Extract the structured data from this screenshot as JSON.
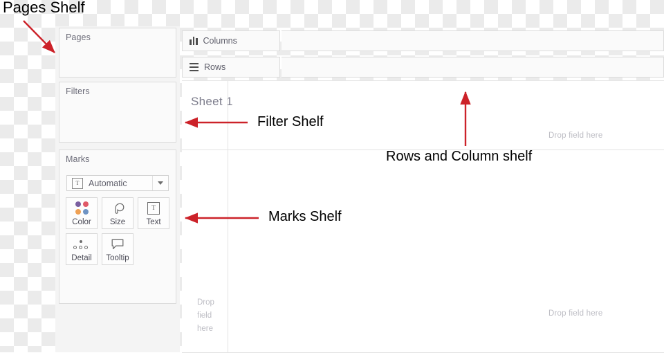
{
  "app": {
    "name": "Tableau Worksheet",
    "sheet_title": "Sheet 1",
    "accent_color": "#cc2229",
    "panel_bg": "#f4f4f4"
  },
  "cards": {
    "pages": {
      "title": "Pages"
    },
    "filters": {
      "title": "Filters"
    },
    "marks": {
      "title": "Marks",
      "mark_type": {
        "value": "Automatic",
        "icon": "text-box-icon",
        "caret": "chevron-down-icon"
      },
      "buttons": [
        {
          "id": "color",
          "label": "Color",
          "icon": "color-dots-icon"
        },
        {
          "id": "size",
          "label": "Size",
          "icon": "size-teardrop-icon"
        },
        {
          "id": "text",
          "label": "Text",
          "icon": "text-box-icon"
        },
        {
          "id": "detail",
          "label": "Detail",
          "icon": "detail-dots-icon"
        },
        {
          "id": "tooltip",
          "label": "Tooltip",
          "icon": "speech-bubble-icon"
        }
      ],
      "color_swatches": [
        "#7a5fa0",
        "#e05a68",
        "#efa154",
        "#6f94c4"
      ]
    }
  },
  "shelves": {
    "columns": {
      "label": "Columns",
      "icon": "columns-bars-icon",
      "value": ""
    },
    "rows": {
      "label": "Rows",
      "icon": "rows-lines-icon",
      "value": ""
    }
  },
  "sheet": {
    "title": "Sheet 1",
    "drop_hint_top_right": "Drop field here",
    "drop_hint_bottom_right": "Drop field here",
    "drop_hint_left": "Drop field here"
  },
  "annotations": [
    {
      "id": "pages",
      "text": "Pages Shelf",
      "arrow": "diagonal-down-right"
    },
    {
      "id": "filter",
      "text": "Filter Shelf",
      "arrow": "left"
    },
    {
      "id": "marks",
      "text": "Marks Shelf",
      "arrow": "left"
    },
    {
      "id": "rows-column",
      "text": "Rows and Column shelf",
      "arrow": "up"
    }
  ]
}
